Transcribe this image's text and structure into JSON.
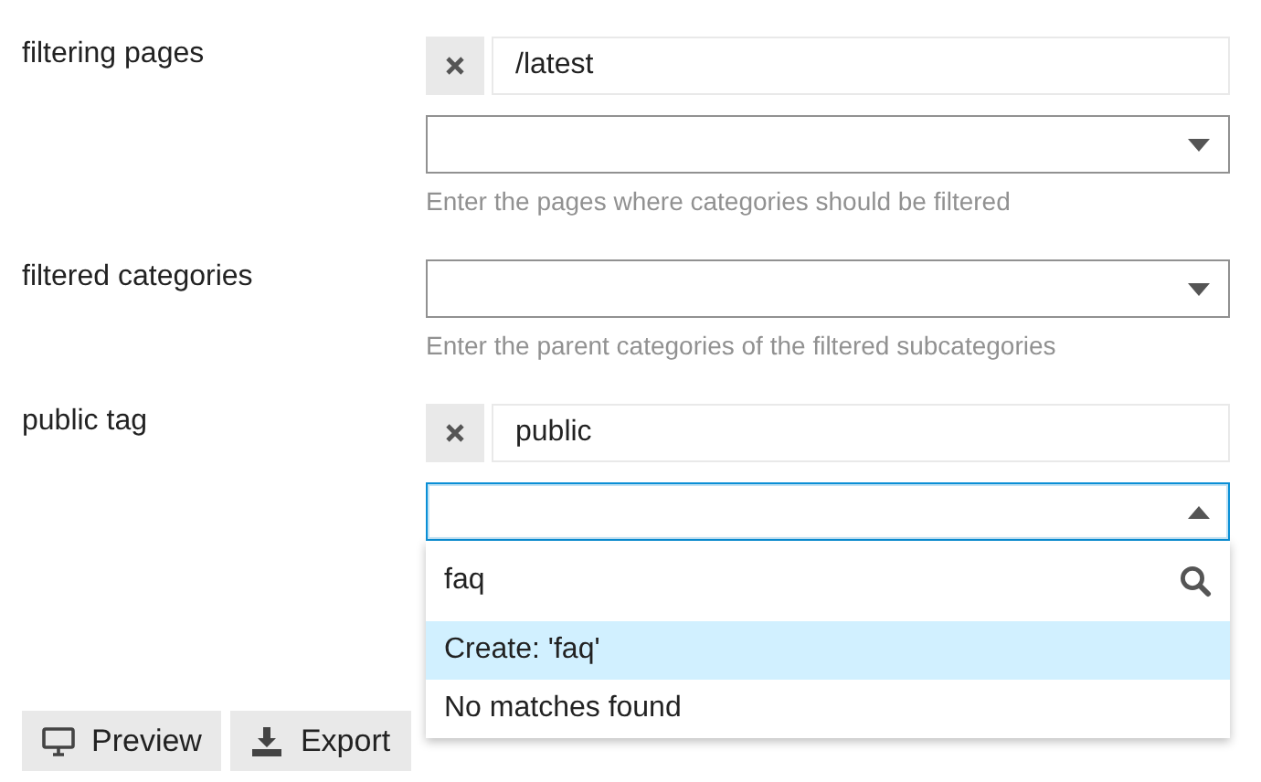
{
  "settings": [
    {
      "label": "filtering pages",
      "values": [
        "/latest"
      ],
      "dropdown": {
        "expanded": false
      },
      "help": "Enter the pages where categories should be filtered"
    },
    {
      "label": "filtered categories",
      "dropdown": {
        "expanded": false
      },
      "help": "Enter the parent categories of the filtered subcategories"
    },
    {
      "label": "public tag",
      "values": [
        "public"
      ],
      "dropdown": {
        "expanded": true,
        "search": {
          "value": "faq"
        },
        "options": [
          {
            "label": "Create: 'faq'",
            "selected": true
          },
          {
            "label": "No matches found",
            "selected": false
          }
        ]
      }
    }
  ],
  "buttons": [
    {
      "label": "Preview",
      "kind": "monitor"
    },
    {
      "label": "Export",
      "kind": "download"
    }
  ]
}
